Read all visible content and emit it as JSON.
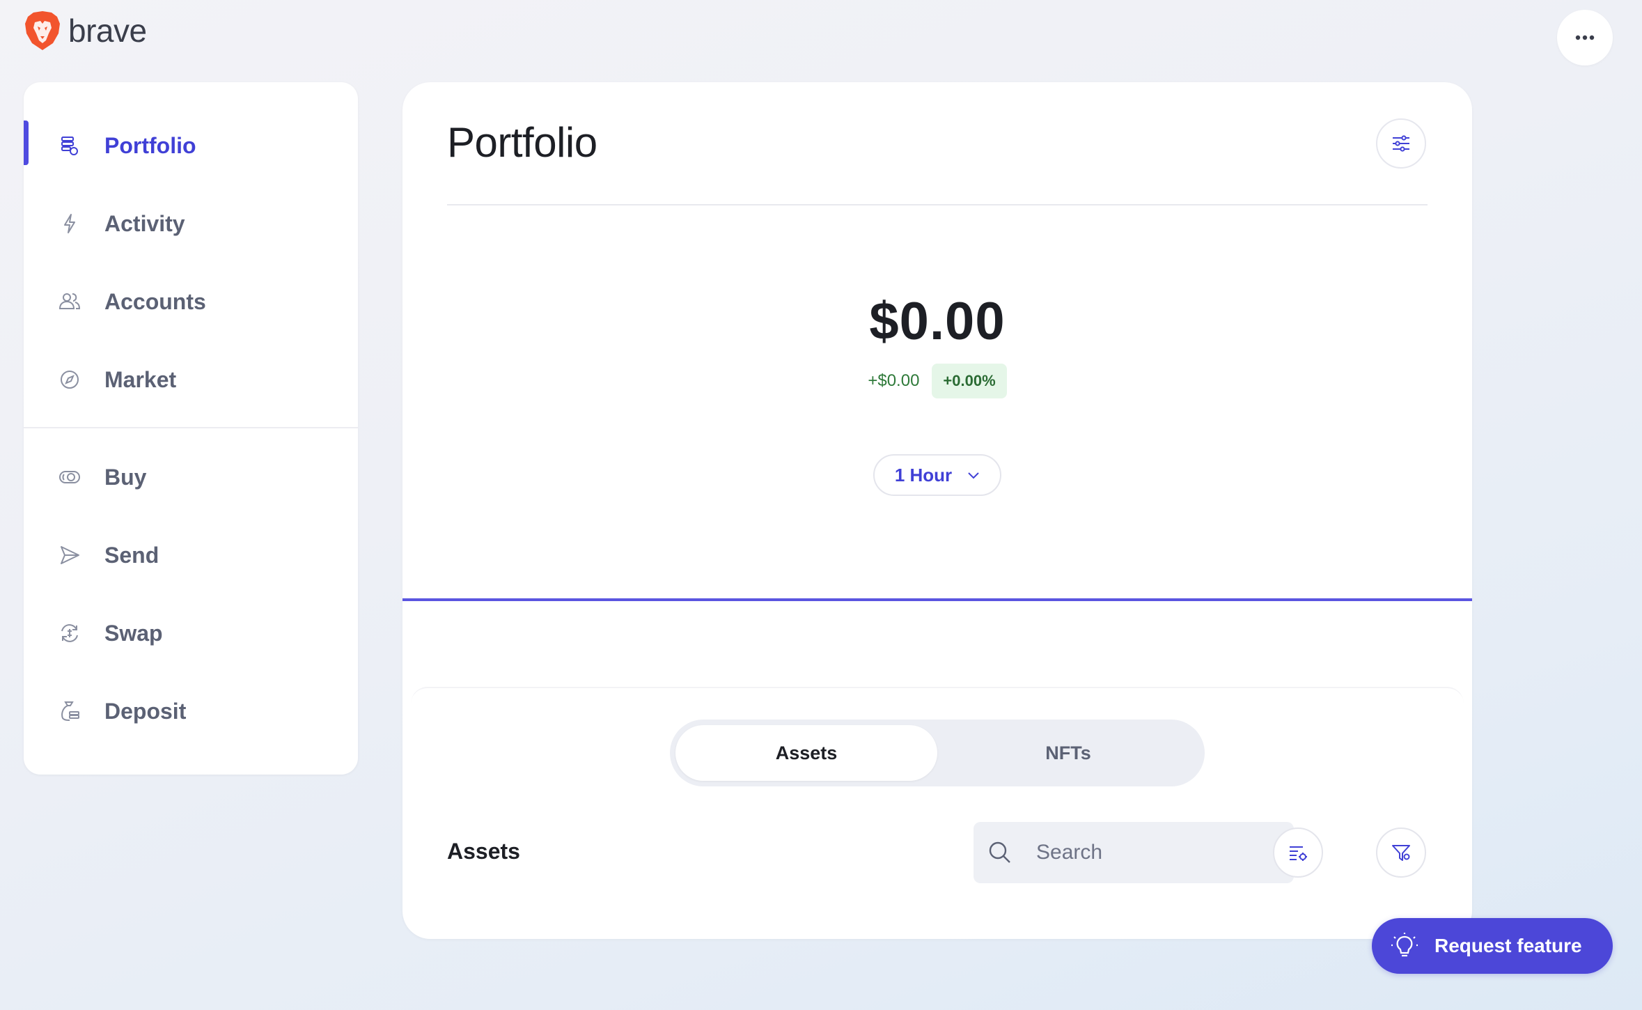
{
  "app": {
    "brand": "brave",
    "more_icon": "more-horizontal-icon"
  },
  "sidebar": {
    "items": [
      {
        "label": "Portfolio",
        "icon": "portfolio-icon",
        "active": true
      },
      {
        "label": "Activity",
        "icon": "lightning-icon",
        "active": false
      },
      {
        "label": "Accounts",
        "icon": "users-icon",
        "active": false
      },
      {
        "label": "Market",
        "icon": "compass-icon",
        "active": false
      },
      {
        "label": "Buy",
        "icon": "cash-icon",
        "active": false
      },
      {
        "label": "Send",
        "icon": "send-icon",
        "active": false
      },
      {
        "label": "Swap",
        "icon": "swap-icon",
        "active": false
      },
      {
        "label": "Deposit",
        "icon": "deposit-icon",
        "active": false
      }
    ]
  },
  "main": {
    "title": "Portfolio",
    "settings_icon": "sliders-icon",
    "balance": "$0.00",
    "change_amount": "+$0.00",
    "change_percent": "+0.00%",
    "timeframe": "1 Hour",
    "tabs": [
      {
        "label": "Assets",
        "selected": true
      },
      {
        "label": "NFTs",
        "selected": false
      }
    ],
    "assets_heading": "Assets",
    "search": {
      "placeholder": "Search",
      "value": ""
    }
  },
  "request_feature": {
    "label": "Request feature",
    "icon": "lightbulb-icon"
  },
  "colors": {
    "accent": "#4c47d8",
    "positive_text": "#2f7a3a",
    "positive_bg": "#e5f6e8",
    "nav_text": "#5b6174"
  }
}
